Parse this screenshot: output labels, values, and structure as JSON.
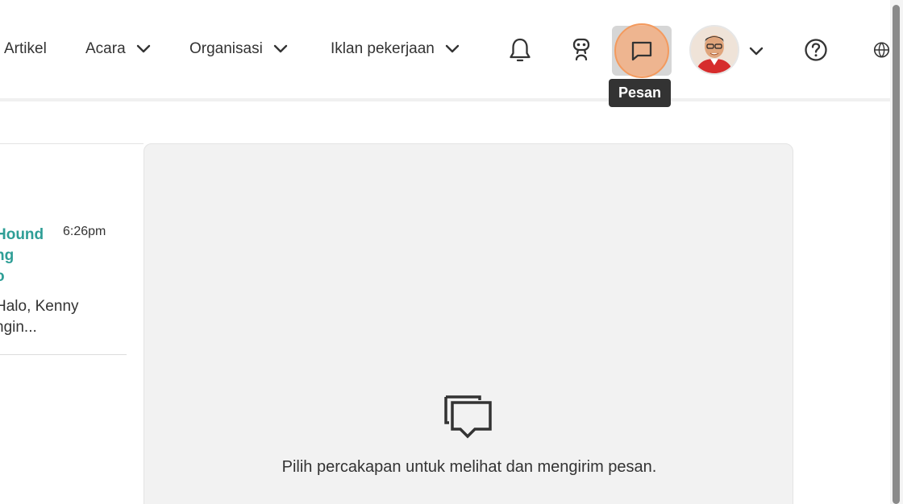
{
  "nav": {
    "artikel": "Artikel",
    "acara": "Acara",
    "organisasi": "Organisasi",
    "iklan": "Iklan pekerjaan"
  },
  "tooltip": {
    "messages": "Pesan"
  },
  "conversations": [
    {
      "name_lines": [
        "Hound",
        "ng",
        "o"
      ],
      "time": "6:26pm",
      "preview_lines": [
        "Halo, Kenny",
        "ngin..."
      ]
    }
  ],
  "main": {
    "empty_text": "Pilih percakapan untuk melihat dan mengirim pesan."
  },
  "icons": {
    "notifications": "bell-icon",
    "assistant": "robot-icon",
    "messages": "chat-bubble-icon",
    "help": "help-circle-icon",
    "language": "globe-icon"
  },
  "colors": {
    "accent_teal": "#2e9e96",
    "highlight_orange": "#f39a5e",
    "tooltip_bg": "#333333",
    "pane_bg": "#f2f2f2"
  }
}
